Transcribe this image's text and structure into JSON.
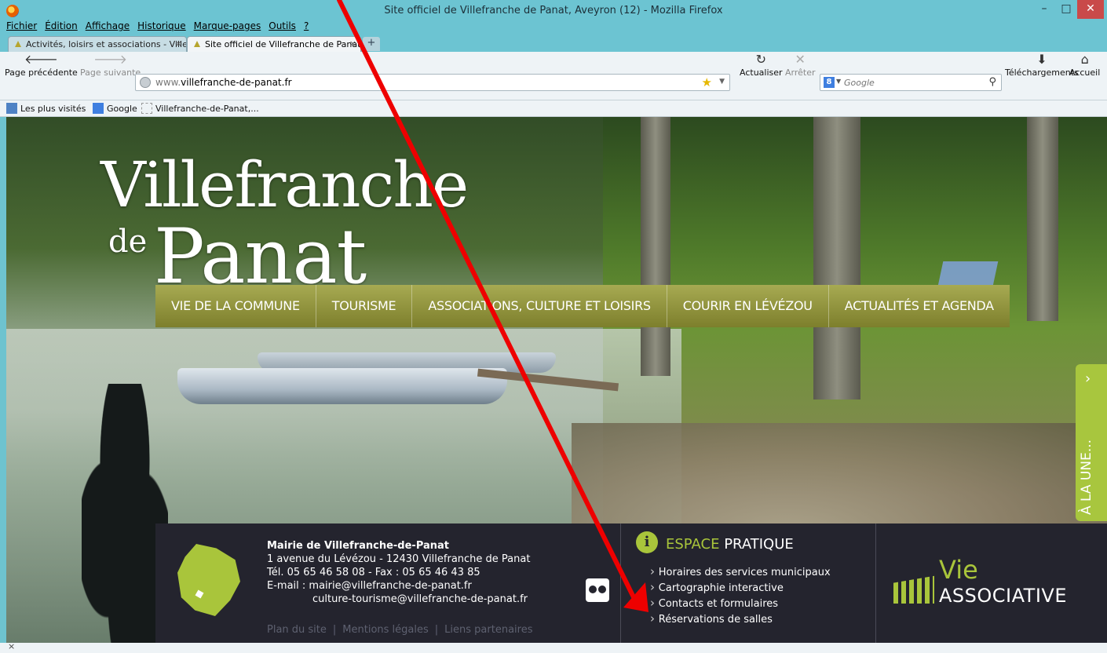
{
  "window": {
    "title": "Site officiel de Villefranche de Panat, Aveyron (12) - Mozilla Firefox",
    "min": "–",
    "max": "□",
    "close": "✕"
  },
  "menu": [
    "Fichier",
    "Édition",
    "Affichage",
    "Historique",
    "Marque-pages",
    "Outils",
    "?"
  ],
  "tabs": [
    {
      "label": "Activités, loisirs et associations - Villef...",
      "close": "×"
    },
    {
      "label": "Site officiel de Villefranche de Panat, ...",
      "close": "×"
    }
  ],
  "new_tab": "+",
  "nav": {
    "back": "Page précédente",
    "forward": "Page suivante",
    "url_prefix": "www.",
    "url_domain": "villefranche-de-panat.fr",
    "reload": "Actualiser",
    "stop": "Arrêter",
    "search_placeholder": "Google",
    "downloads": "Téléchargements",
    "home": "Accueil"
  },
  "bookmarks": [
    "Les plus visités",
    "Google",
    "Villefranche-de-Panat,..."
  ],
  "site": {
    "logo_line1": "Villefranche",
    "logo_de": "de",
    "logo_line2": "Panat",
    "menu": [
      "VIE DE LA COMMUNE",
      "TOURISME",
      "ASSOCIATIONS, CULTURE ET LOISIRS",
      "COURIR EN LÉVÉZOU",
      "ACTUALITÉS ET AGENDA"
    ],
    "a_la_une": "À LA UNE...",
    "footer": {
      "name": "Mairie de Villefranche-de-Panat",
      "address": "1 avenue du Lévézou - 12430 Villefranche de Panat",
      "phone": "Tél. 05 65 46 58 08 - Fax : 05 65 46 43 85",
      "email1": "E-mail : mairie@villefranche-de-panat.fr",
      "email2": "culture-tourisme@villefranche-de-panat.fr",
      "links": [
        "Plan du site",
        "Mentions légales",
        "Liens partenaires"
      ],
      "espace_green": "ESPACE",
      "espace_white": "PRATIQUE",
      "espace_items": [
        "Horaires des services municipaux",
        "Cartographie interactive",
        "Contacts et formulaires",
        "Réservations de salles"
      ],
      "vie": "Vie",
      "associative": "ASSOCIATIVE"
    }
  },
  "status": {
    "close": "×"
  }
}
